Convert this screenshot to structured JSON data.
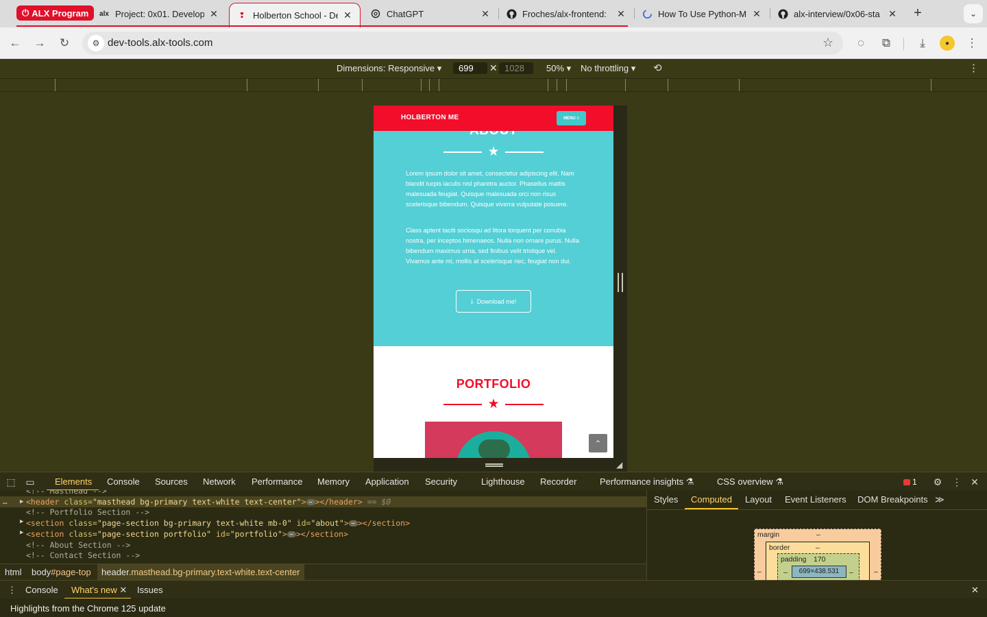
{
  "browser": {
    "tab_group": {
      "label": "ALX Program",
      "color": "#e0102a"
    },
    "tabs": [
      {
        "title": "Project: 0x01. Develop",
        "icon": "alx-icon"
      },
      {
        "title": "Holberton School - De",
        "icon": "holberton-icon",
        "active": true
      },
      {
        "title": "ChatGPT",
        "icon": "chatgpt-icon"
      },
      {
        "title": "Froches/alx-frontend:",
        "icon": "github-icon"
      },
      {
        "title": "How To Use Python-M",
        "icon": "loading-icon"
      },
      {
        "title": "alx-interview/0x06-sta",
        "icon": "github-icon"
      }
    ],
    "url": "dev-tools.alx-tools.com"
  },
  "device_toolbar": {
    "dimensions_label": "Dimensions: Responsive",
    "width": "699",
    "height": "1028",
    "zoom": "50%",
    "throttling": "No throttling"
  },
  "page": {
    "brand": "HOLBERTON ME",
    "menu_label": "MENU",
    "about": {
      "heading": "ABOUT",
      "para1": "Lorem ipsum dolor sit amet, consectetur adipiscing elit. Nam blandit turpis iaculis nisl pharetra auctor. Phasellus mattis malesuada feugiat. Quisque malesuada orci non risus scelerisque bibendum. Quisque viverra vulputate posuere.",
      "para2": "Class aptent taciti sociosqu ad litora torquent per conubia nostra, per inceptos himenaeos. Nulla non ornare purus. Nulla bibendum maximus urna, sed finibus velit tristique vel. Vivamus ante mi, mollis at scelerisque nec, feugiat non dui.",
      "download_label": "Download me!"
    },
    "portfolio": {
      "heading": "PORTFOLIO"
    },
    "colors": {
      "primary": "#f20d2a",
      "about_bg": "#53cfd5",
      "menu_btn": "#43c8cc"
    }
  },
  "devtools": {
    "tabs": [
      "Elements",
      "Console",
      "Sources",
      "Network",
      "Performance",
      "Memory",
      "Application",
      "Security",
      "Lighthouse",
      "Recorder",
      "Performance insights",
      "CSS overview"
    ],
    "error_count": "1",
    "elements": {
      "line_top": "<!-- Masthead -->",
      "selected_tag_open": "<header",
      "selected_attr": " class=",
      "selected_val": "\"masthead bg-primary text-white text-center\"",
      "selected_close": "></header>",
      "selected_eq": " == $0",
      "comment_portfolio": "<!-- Portfolio Section -->",
      "section1_open": "<section",
      "section1_attr": " class=",
      "section1_val": "\"page-section bg-primary text-white mb-0\"",
      "section1_id_attr": " id=",
      "section1_id_val": "\"about\"",
      "section1_close": "></section>",
      "section2_open": "<section",
      "section2_attr": " class=",
      "section2_val": "\"page-section portfolio\"",
      "section2_id_attr": " id=",
      "section2_id_val": "\"portfolio\"",
      "section2_close": "></section>",
      "comment_about": "<!-- About Section -->",
      "comment_contact": "<!-- Contact Section -->"
    },
    "breadcrumbs": {
      "html": "html",
      "body": "body",
      "body_id": "#page-top",
      "header": "header",
      "header_classes": ".masthead.bg-primary.text-white.text-center"
    },
    "side_tabs": [
      "Styles",
      "Computed",
      "Layout",
      "Event Listeners",
      "DOM Breakpoints"
    ],
    "box_model": {
      "margin_label": "margin",
      "margin_value": "–",
      "border_label": "border",
      "border_value": "–",
      "padding_label": "padding",
      "padding_value": "170",
      "content": "699×438.531",
      "side_dash": "–"
    },
    "drawer": {
      "tabs": [
        "Console",
        "What's new",
        "Issues"
      ],
      "message": "Highlights from the Chrome 125 update"
    }
  }
}
